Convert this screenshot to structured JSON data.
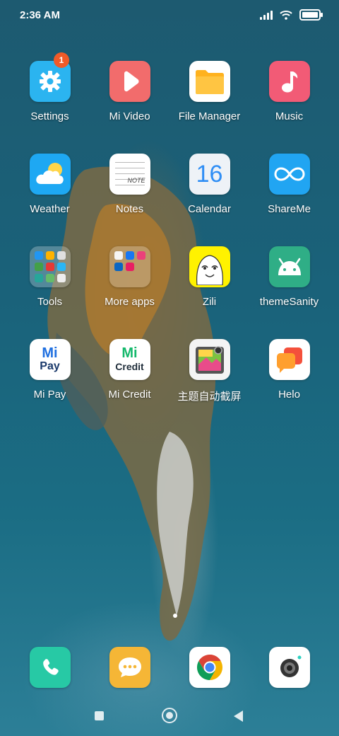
{
  "status_bar": {
    "time": "2:36 AM"
  },
  "apps": [
    {
      "label": "Settings",
      "icon": "gear-icon",
      "color": "#2bb4f0",
      "badge": "1"
    },
    {
      "label": "Mi Video",
      "icon": "play-icon",
      "color": "#f26c6c"
    },
    {
      "label": "File Manager",
      "icon": "folder-icon",
      "color": "#ffffff"
    },
    {
      "label": "Music",
      "icon": "music-note-icon",
      "color": "#f25b76"
    },
    {
      "label": "Weather",
      "icon": "cloud-sun-icon",
      "color": "#1ea8f3"
    },
    {
      "label": "Notes",
      "icon": "notepad-icon",
      "color": "#ffffff",
      "icon_text": "NOTE"
    },
    {
      "label": "Calendar",
      "icon": "calendar-icon",
      "color": "#eef2f7",
      "icon_text": "16"
    },
    {
      "label": "ShareMe",
      "icon": "infinity-icon",
      "color": "#21a5f2"
    },
    {
      "label": "Tools",
      "icon": "folder-icon",
      "color": "rgba(255,255,255,0.25)"
    },
    {
      "label": "More apps",
      "icon": "folder-icon",
      "color": "rgba(255,255,255,0.25)"
    },
    {
      "label": "Zili",
      "icon": "smiley-icon",
      "color": "#fff200"
    },
    {
      "label": "themeSanity",
      "icon": "android-icon",
      "color": "#2fae86"
    },
    {
      "label": "Mi Pay",
      "icon": "mi-pay-icon",
      "color": "#ffffff",
      "icon_text_top": "Mi",
      "icon_text_bottom": "Pay"
    },
    {
      "label": "Mi Credit",
      "icon": "mi-credit-icon",
      "color": "#ffffff",
      "icon_text_top": "Mi",
      "icon_text_bottom": "Credit"
    },
    {
      "label": "主题自动截屏",
      "icon": "screenshot-icon",
      "color": "#f4f4f4"
    },
    {
      "label": "Helo",
      "icon": "chat-bubbles-icon",
      "color": "#ffffff"
    }
  ],
  "dock": [
    {
      "icon": "phone-icon",
      "color": "#27c9a5"
    },
    {
      "icon": "message-icon",
      "color": "#f5b636"
    },
    {
      "icon": "chrome-icon",
      "color": "#ffffff"
    },
    {
      "icon": "camera-icon",
      "color": "#ffffff"
    }
  ]
}
